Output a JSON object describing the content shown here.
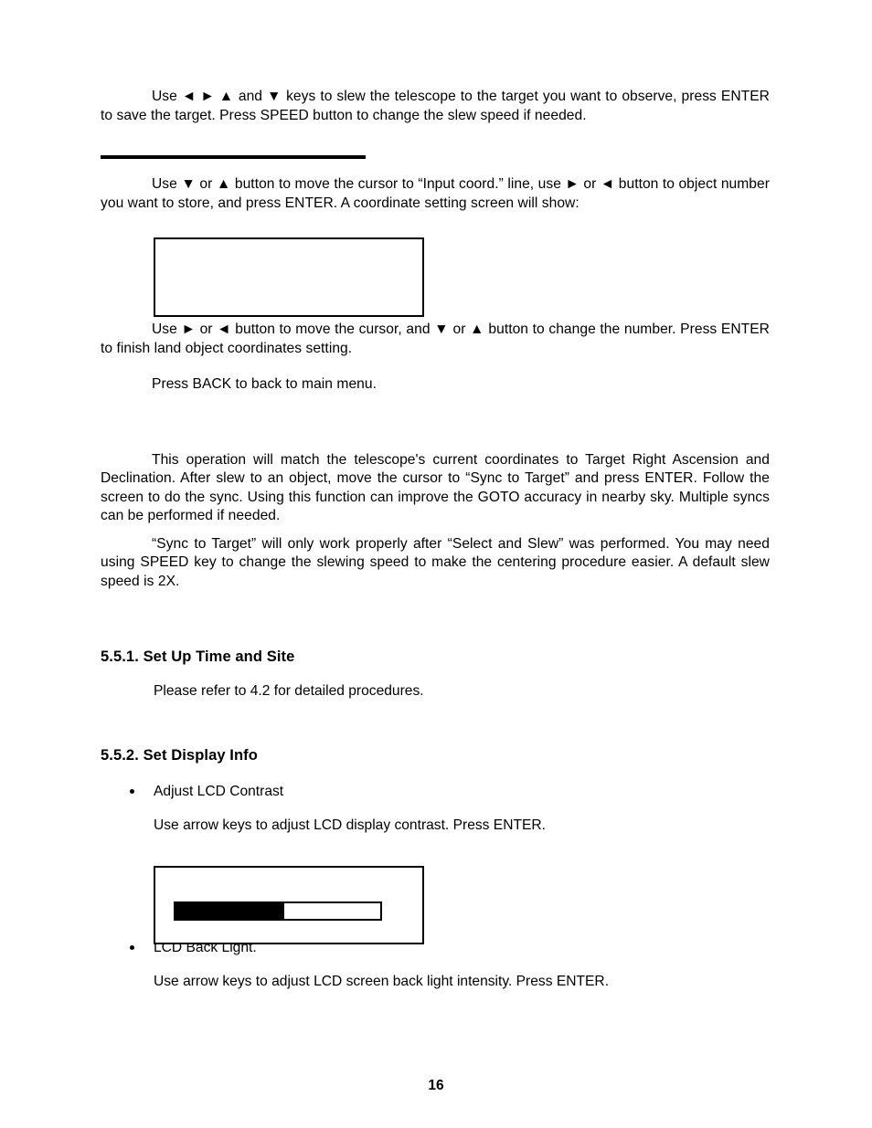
{
  "document": {
    "page_number": "16",
    "paragraphs": {
      "slew_target": "Use ◄ ► ▲ and ▼ keys to slew the telescope to the target you want to observe, press ENTER to save the target. Press SPEED button to change the slew speed if needed.",
      "input_coord": "Use ▼ or ▲ button to move the cursor to “Input coord.” line, use ► or ◄ button to object number you want to store, and press ENTER. A coordinate setting screen will show:",
      "move_cursor": "Use ► or ◄ button to move the cursor, and ▼ or ▲ button to change the number. Press ENTER to finish land object coordinates setting.",
      "press_back": "Press BACK to back to main menu.",
      "sync_operation": "This operation will match the telescope's current coordinates to Target Right Ascension and Declination. After slew to an object, move the cursor to “Sync to Target” and press ENTER. Follow the screen to do the sync. Using this function can improve the GOTO accuracy in nearby sky. Multiple syncs can be performed if needed.",
      "sync_note": "“Sync to Target” will only work properly after “Select and Slew” was performed. You may need using SPEED key to change the slewing speed to make the centering procedure easier. A default slew speed is 2X."
    },
    "sections": [
      {
        "heading": "5.5.1. Set Up Time and Site",
        "body": "Please refer to 4.2 for detailed procedures."
      },
      {
        "heading": "5.5.2. Set Display Info",
        "bullets": [
          {
            "label": "Adjust LCD Contrast",
            "body": "Use arrow keys to adjust LCD display contrast. Press ENTER."
          },
          {
            "label": "LCD Back Light.",
            "body": "Use arrow keys to adjust LCD screen back light intensity. Press ENTER."
          }
        ]
      }
    ],
    "figures": {
      "coord_screen": {
        "caption": "",
        "content": ""
      },
      "contrast_screen": {
        "fill_percent": 53
      }
    },
    "colors": {
      "text": "#000000",
      "background": "#ffffff",
      "rule": "#000000",
      "bar_fill": "#000000"
    }
  }
}
